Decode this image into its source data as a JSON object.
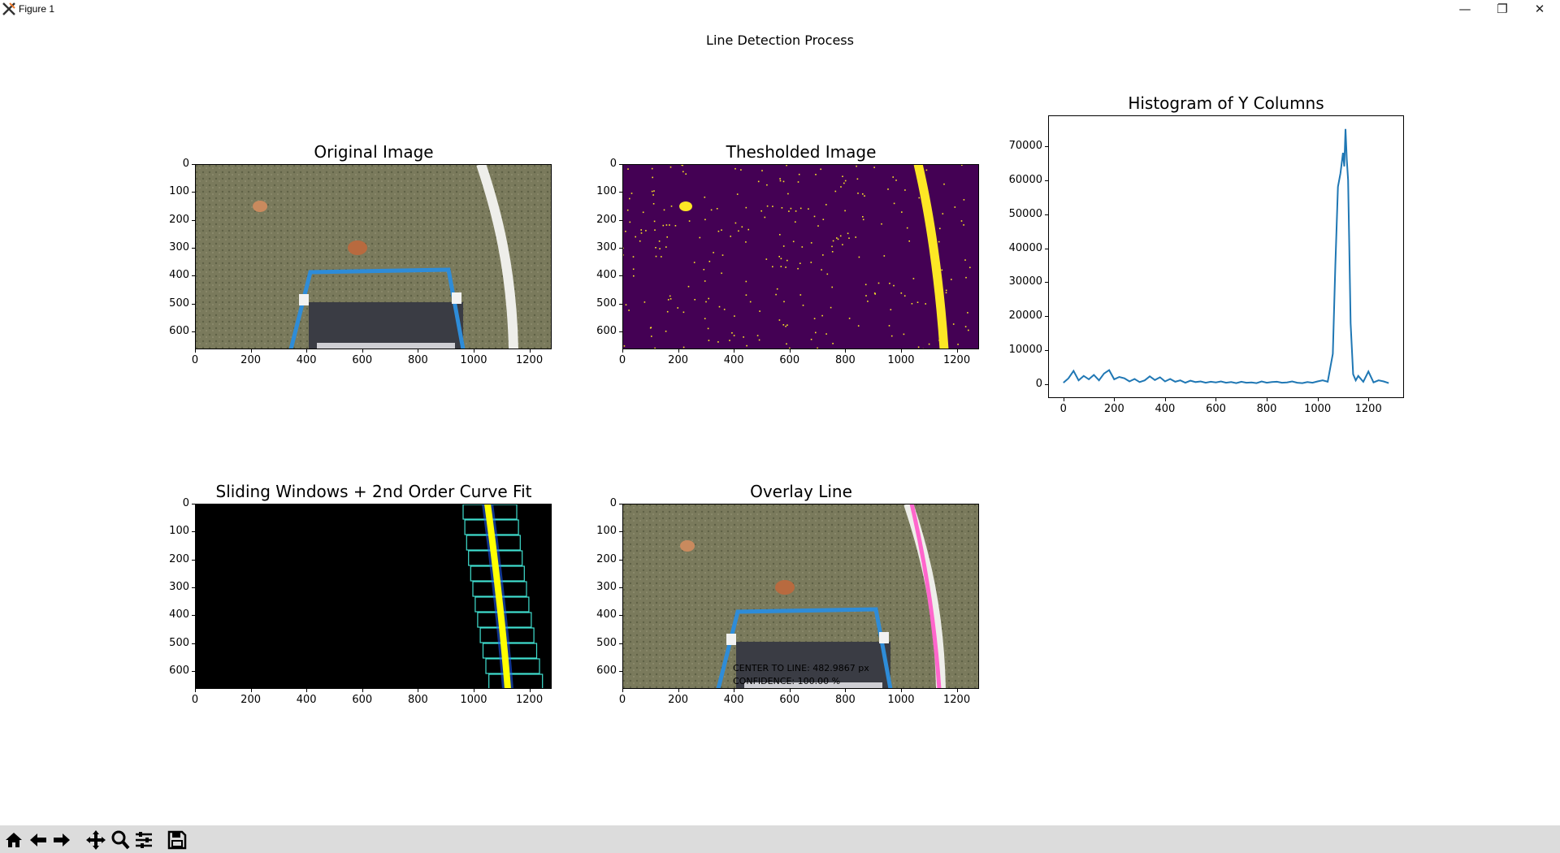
{
  "window": {
    "title": "Figure 1",
    "controls": {
      "minimize": "—",
      "restore": "❐",
      "close": "✕"
    }
  },
  "figure": {
    "suptitle": "Line Detection Process"
  },
  "axes": {
    "original": {
      "title": "Original Image",
      "xticks": [
        "0",
        "200",
        "400",
        "600",
        "800",
        "1000",
        "1200"
      ],
      "yticks": [
        "0",
        "100",
        "200",
        "300",
        "400",
        "500",
        "600"
      ]
    },
    "threshold": {
      "title": "Thesholded Image",
      "xticks": [
        "0",
        "200",
        "400",
        "600",
        "800",
        "1000",
        "1200"
      ],
      "yticks": [
        "0",
        "100",
        "200",
        "300",
        "400",
        "500",
        "600"
      ]
    },
    "histogram": {
      "title": "Histogram of Y Columns",
      "xticks": [
        "0",
        "200",
        "400",
        "600",
        "800",
        "1000",
        "1200"
      ],
      "yticks": [
        "0",
        "10000",
        "20000",
        "30000",
        "40000",
        "50000",
        "60000",
        "70000"
      ]
    },
    "sliding": {
      "title": "Sliding Windows + 2nd Order Curve Fit",
      "xticks": [
        "0",
        "200",
        "400",
        "600",
        "800",
        "1000",
        "1200"
      ],
      "yticks": [
        "0",
        "100",
        "200",
        "300",
        "400",
        "500",
        "600"
      ]
    },
    "overlay": {
      "title": "Overlay Line",
      "xticks": [
        "0",
        "200",
        "400",
        "600",
        "800",
        "1000",
        "1200"
      ],
      "yticks": [
        "0",
        "100",
        "200",
        "300",
        "400",
        "500",
        "600"
      ],
      "text_center": "CENTER TO LINE: 482.9867 px",
      "text_confidence": "CONFIDENCE: 100.00 %"
    }
  },
  "chart_data": [
    {
      "type": "line",
      "title": "Histogram of Y Columns",
      "xlabel": "",
      "ylabel": "",
      "xlim": [
        -60,
        1340
      ],
      "ylim": [
        -4000,
        79000
      ],
      "series": [
        {
          "color": "#1f77b4",
          "x": [
            0,
            20,
            40,
            60,
            80,
            100,
            120,
            140,
            160,
            180,
            200,
            220,
            240,
            260,
            280,
            300,
            320,
            340,
            360,
            380,
            400,
            420,
            440,
            460,
            480,
            500,
            520,
            540,
            560,
            580,
            600,
            620,
            640,
            660,
            680,
            700,
            720,
            740,
            760,
            780,
            800,
            820,
            840,
            860,
            880,
            900,
            920,
            940,
            960,
            980,
            1000,
            1020,
            1040,
            1060,
            1070,
            1080,
            1090,
            1100,
            1105,
            1110,
            1115,
            1120,
            1125,
            1130,
            1140,
            1150,
            1160,
            1180,
            1200,
            1220,
            1240,
            1260,
            1280
          ],
          "y": [
            500,
            1800,
            4000,
            1200,
            2500,
            1500,
            2800,
            1200,
            3200,
            4200,
            1500,
            2200,
            1800,
            900,
            1600,
            700,
            1200,
            2400,
            1300,
            2100,
            900,
            1600,
            800,
            1200,
            500,
            1100,
            700,
            900,
            500,
            800,
            600,
            900,
            500,
            700,
            400,
            800,
            500,
            600,
            400,
            900,
            500,
            700,
            800,
            500,
            600,
            900,
            500,
            400,
            700,
            500,
            900,
            1200,
            800,
            9000,
            35000,
            58000,
            62000,
            68000,
            64000,
            75000,
            66000,
            60000,
            40000,
            18000,
            3000,
            1200,
            2500,
            800,
            3800,
            600,
            1200,
            900,
            400
          ]
        }
      ]
    }
  ],
  "toolbar": {
    "buttons": [
      "home-icon",
      "back-icon",
      "forward-icon",
      "pan-icon",
      "zoom-icon",
      "configure-subplots-icon",
      "save-icon"
    ]
  }
}
